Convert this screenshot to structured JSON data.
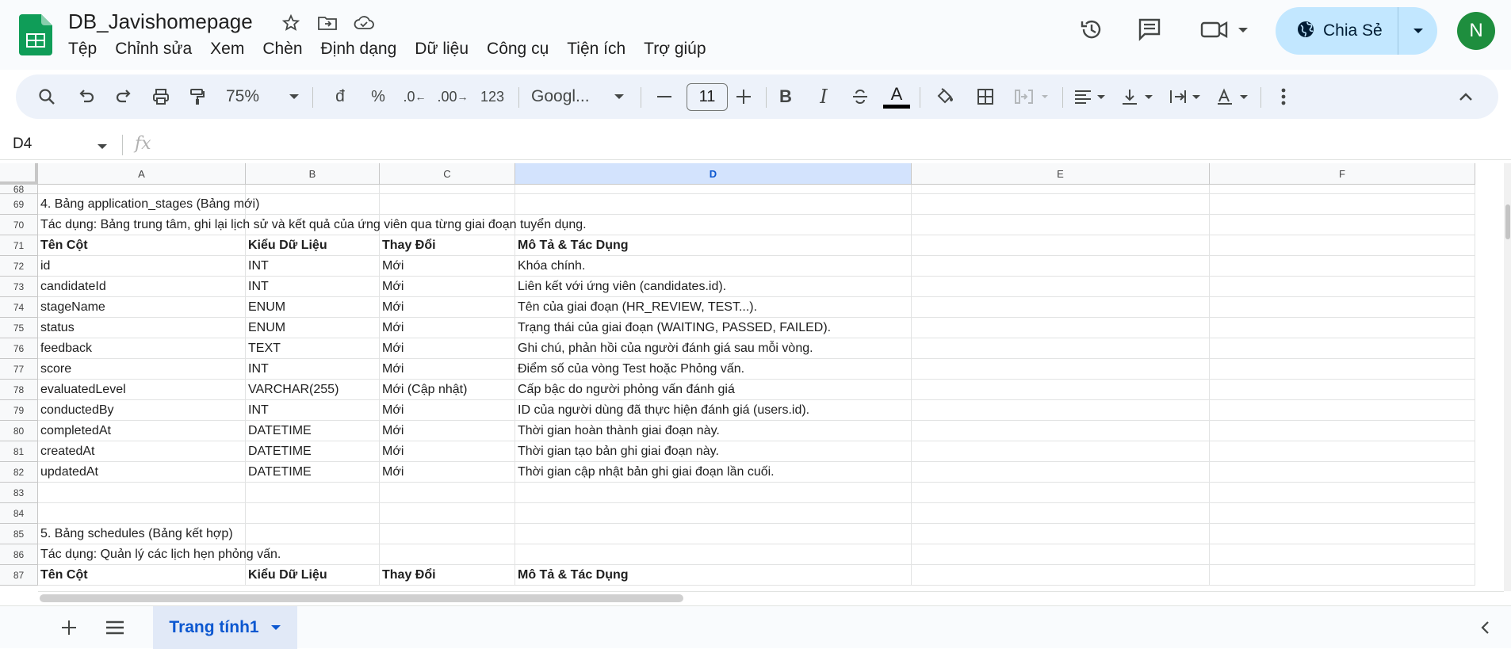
{
  "app": {
    "title": "DB_Javishomepage",
    "menu": [
      "Tệp",
      "Chỉnh sửa",
      "Xem",
      "Chèn",
      "Định dạng",
      "Dữ liệu",
      "Công cụ",
      "Tiện ích",
      "Trợ giúp"
    ],
    "share_label": "Chia Sẻ",
    "avatar_letter": "N",
    "colors": {
      "share_bg": "#c2e7ff",
      "avatar": "#1e8e3e",
      "sheets_green": "#0f9d58",
      "selected_header": "#d3e3fd",
      "accent": "#0b57d0"
    }
  },
  "toolbar": {
    "zoom": "75%",
    "currency": "đ",
    "percent": "%",
    "decrease_decimal": ".0",
    "increase_decimal": ".00",
    "number_format": "123",
    "font": "Googl...",
    "font_size": "11",
    "text_color_letter": "A",
    "icons": [
      "search-icon",
      "undo-icon",
      "redo-icon",
      "print-icon",
      "paint-format-icon",
      "fill-color-icon",
      "borders-icon",
      "merge-icon",
      "align-icon",
      "valign-icon",
      "wrap-icon",
      "rotate-icon",
      "more-icon",
      "collapse-icon"
    ]
  },
  "formula_bar": {
    "name_box": "D4",
    "fx": "fx",
    "value": ""
  },
  "columns": [
    "A",
    "B",
    "C",
    "D",
    "E",
    "F"
  ],
  "selected_column": "D",
  "rows": [
    {
      "n": "68",
      "bold": false,
      "cells": [
        "",
        "",
        "",
        ""
      ]
    },
    {
      "n": "69",
      "bold": false,
      "cells": [
        "4. Bảng application_stages (Bảng mới)",
        "",
        "",
        ""
      ]
    },
    {
      "n": "70",
      "bold": false,
      "cells": [
        "Tác dụng: Bảng trung tâm, ghi lại lịch sử và kết quả của ứng viên qua từng giai đoạn tuyển dụng.",
        "",
        "",
        ""
      ]
    },
    {
      "n": "71",
      "bold": true,
      "cells": [
        "Tên Cột",
        "Kiểu Dữ Liệu",
        "Thay Đổi",
        "Mô Tả & Tác Dụng"
      ]
    },
    {
      "n": "72",
      "bold": false,
      "cells": [
        "id",
        "INT",
        "Mới",
        "Khóa chính."
      ]
    },
    {
      "n": "73",
      "bold": false,
      "cells": [
        "candidateId",
        "INT",
        "Mới",
        "Liên kết với ứng viên (candidates.id)."
      ]
    },
    {
      "n": "74",
      "bold": false,
      "cells": [
        "stageName",
        "ENUM",
        "Mới",
        "Tên của giai đoạn (HR_REVIEW, TEST...)."
      ]
    },
    {
      "n": "75",
      "bold": false,
      "cells": [
        "status",
        "ENUM",
        "Mới",
        "Trạng thái của giai đoạn (WAITING, PASSED, FAILED)."
      ]
    },
    {
      "n": "76",
      "bold": false,
      "cells": [
        "feedback",
        "TEXT",
        "Mới",
        "Ghi chú, phản hồi của người đánh giá sau mỗi vòng."
      ]
    },
    {
      "n": "77",
      "bold": false,
      "cells": [
        "score",
        "INT",
        "Mới",
        "Điểm số của vòng Test hoặc Phỏng vấn."
      ]
    },
    {
      "n": "78",
      "bold": false,
      "cells": [
        "evaluatedLevel",
        "VARCHAR(255)",
        "Mới (Cập nhật)",
        "Cấp bậc do người phỏng vấn đánh giá"
      ]
    },
    {
      "n": "79",
      "bold": false,
      "cells": [
        "conductedBy",
        "INT",
        "Mới",
        "ID của người dùng đã thực hiện đánh giá (users.id)."
      ]
    },
    {
      "n": "80",
      "bold": false,
      "cells": [
        "completedAt",
        "DATETIME",
        "Mới",
        "Thời gian hoàn thành giai đoạn này."
      ]
    },
    {
      "n": "81",
      "bold": false,
      "cells": [
        "createdAt",
        "DATETIME",
        "Mới",
        "Thời gian tạo bản ghi giai đoạn này."
      ]
    },
    {
      "n": "82",
      "bold": false,
      "cells": [
        "updatedAt",
        "DATETIME",
        "Mới",
        "Thời gian cập nhật bản ghi giai đoạn lần cuối."
      ]
    },
    {
      "n": "83",
      "bold": false,
      "cells": [
        "",
        "",
        "",
        ""
      ]
    },
    {
      "n": "84",
      "bold": false,
      "cells": [
        "",
        "",
        "",
        ""
      ]
    },
    {
      "n": "85",
      "bold": false,
      "cells": [
        "5. Bảng schedules (Bảng kết hợp)",
        "",
        "",
        ""
      ]
    },
    {
      "n": "86",
      "bold": false,
      "cells": [
        "Tác dụng: Quản lý các lịch hẹn phỏng vấn.",
        "",
        "",
        ""
      ]
    },
    {
      "n": "87",
      "bold": true,
      "cells": [
        "Tên Cột",
        "Kiểu Dữ Liệu",
        "Thay Đổi",
        "Mô Tả & Tác Dụng"
      ]
    }
  ],
  "sheets": {
    "active": "Trang tính1"
  }
}
